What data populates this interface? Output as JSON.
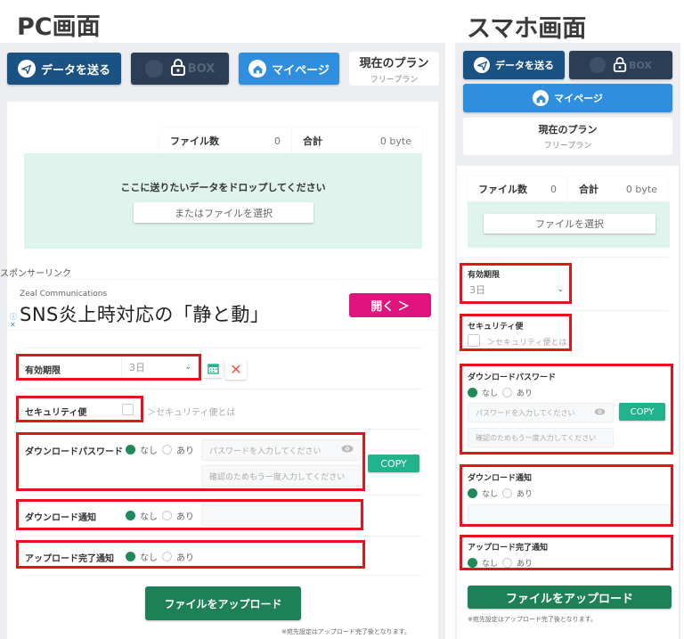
{
  "pc": {
    "heading": "PC画面",
    "nav": {
      "send_label": "データを送る",
      "box_label": "BOX",
      "mypage_label": "マイページ",
      "plan_title": "現在のプラン",
      "plan_name": "フリープラン"
    },
    "stats": {
      "file_count_label": "ファイル数",
      "file_count_value": "0",
      "total_label": "合計",
      "total_value": "0 byte"
    },
    "dropzone": {
      "message": "ここに送りたいデータをドロップしてください",
      "select_label": "またはファイルを選択"
    },
    "sponsor_label": "スポンサーリンク",
    "ad": {
      "advertiser": "Zeal Communications",
      "headline": "SNS炎上時対応の「静と動」",
      "button_label": "開く ＞",
      "info_icon": "ⓘ",
      "close_icon": "✕"
    },
    "form": {
      "expiry_label": "有効期限",
      "expiry_value": "3日",
      "security_label": "セキュリティ便",
      "security_checked": false,
      "security_link": "＞セキュリティ便とは",
      "password_label": "ダウンロードパスワード",
      "password_placeholder": "パスワードを入力してください",
      "password_confirm_placeholder": "確認のためもう一度入力してください",
      "copy_label": "COPY",
      "download_notice_label": "ダウンロード通知",
      "upload_notice_label": "アップロード完了通知",
      "option_off": "なし",
      "option_on": "あり",
      "selected_option": "なし"
    },
    "upload_label": "ファイルをアップロード",
    "note": "※宛先設定はアップロード完了後となります。"
  },
  "sp": {
    "heading": "スマホ画面",
    "nav": {
      "send_label": "データを送る",
      "box_label": "BOX",
      "mypage_label": "マイページ",
      "plan_title": "現在のプラン",
      "plan_name": "フリープラン"
    },
    "stats": {
      "file_count_label": "ファイル数",
      "file_count_value": "0",
      "total_label": "合計",
      "total_value": "0 byte"
    },
    "dropzone": {
      "select_label": "ファイルを選択"
    },
    "form": {
      "expiry_label": "有効期限",
      "expiry_value": "3日",
      "security_label": "セキュリティ便",
      "security_checked": false,
      "security_link": "＞セキュリティ便とは",
      "password_label": "ダウンロードパスワード",
      "password_placeholder": "パスワードを入力してください",
      "password_confirm_placeholder": "確認のためもう一度入力してください",
      "copy_label": "COPY",
      "download_notice_label": "ダウンロード通知",
      "upload_notice_label": "アップロード完了通知",
      "option_off": "なし",
      "option_on": "あり",
      "selected_option": "なし"
    },
    "upload_label": "ファイルをアップロード",
    "note": "※宛先設定はアップロード完了後となります。"
  },
  "colors": {
    "send": "#1b5284",
    "box": "#2c3e55",
    "mypage": "#2f8fde",
    "dropzone": "#e0f4ee",
    "highlight": "#e3141b",
    "upload": "#1e8056",
    "copy": "#21b48c",
    "ad_button": "#e0147f"
  }
}
